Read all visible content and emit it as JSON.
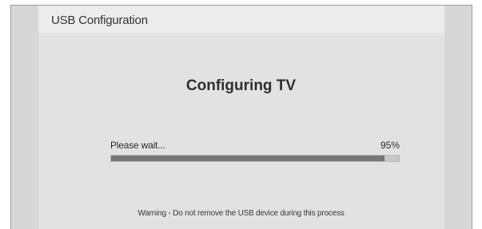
{
  "window": {
    "title": "USB Configuration"
  },
  "main": {
    "title": "Configuring TV",
    "progress": {
      "label": "Please wait...",
      "percent_text": "95%",
      "value": 0.95
    },
    "warning": "Warning - Do not remove the USB device during this process"
  },
  "colors": {
    "progress_fill": "#767676",
    "progress_track": "#c8c8c8",
    "background": "#e2e2e2"
  }
}
